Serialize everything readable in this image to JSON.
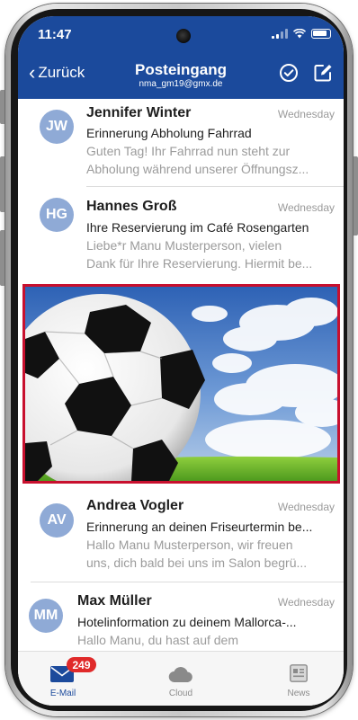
{
  "status_bar": {
    "time": "11:47"
  },
  "header": {
    "back_label": "Zurück",
    "title": "Posteingang",
    "account": "nma_gm19@gmx.de"
  },
  "mails": [
    {
      "initials": "JW",
      "sender": "Jennifer Winter",
      "date": "Wednesday",
      "subject": "Erinnerung Abholung Fahrrad",
      "preview_line1": "Guten Tag! Ihr Fahrrad nun steht zur",
      "preview_line2": "Abholung während unserer Öffnungsz..."
    },
    {
      "initials": "HG",
      "sender": "Hannes Groß",
      "date": "Wednesday",
      "subject": "Ihre Reservierung im Café Rosengarten",
      "preview_line1": "Liebe*r Manu Musterperson, vielen",
      "preview_line2": "Dank für Ihre Reservierung. Hiermit be..."
    },
    {
      "initials": "AV",
      "sender": "Andrea Vogler",
      "date": "Wednesday",
      "subject": "Erinnerung an deinen Friseurtermin be...",
      "preview_line1": "Hallo Manu Musterperson, wir freuen",
      "preview_line2": "uns, dich bald bei uns im Salon begrü..."
    },
    {
      "initials": "MM",
      "sender": "Max Müller",
      "date": "Wednesday",
      "subject": "Hotelinformation zu deinem Mallorca-...",
      "preview_line1": "Hallo Manu, du hast auf dem",
      "preview_line2": ""
    }
  ],
  "tabbar": {
    "mail_label": "E-Mail",
    "mail_badge": "249",
    "cloud_label": "Cloud",
    "news_label": "News"
  },
  "colors": {
    "header_bg": "#1b4a9c",
    "avatar_bg": "#8faad6",
    "ad_border": "#c8102e",
    "badge_bg": "#e02a2a"
  },
  "icons": [
    "chevron-left-icon",
    "check-circle-icon",
    "compose-icon",
    "mail-icon",
    "cloud-icon",
    "news-icon",
    "signal-icon",
    "wifi-icon",
    "battery-icon"
  ]
}
